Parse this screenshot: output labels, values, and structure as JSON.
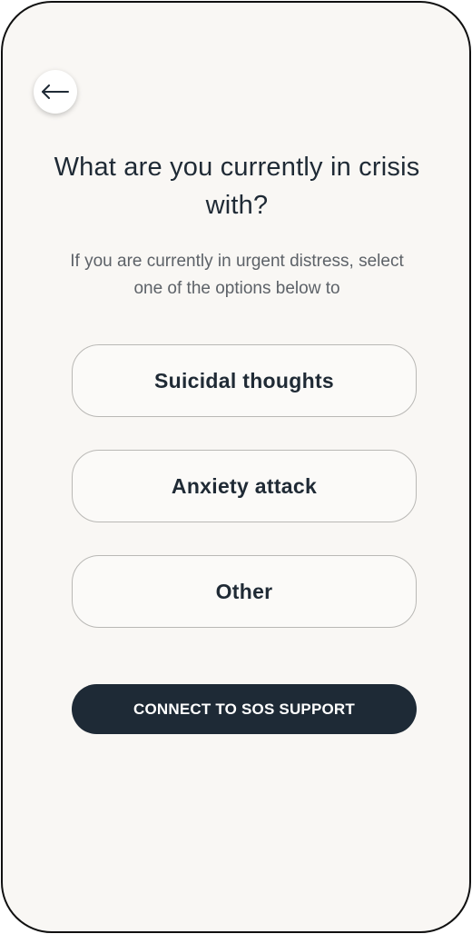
{
  "header": {
    "back_icon": "arrow-left-icon"
  },
  "main": {
    "title": "What are you currently in crisis with?",
    "subtitle": "If you are currently in urgent distress, select one of the options below to",
    "options": [
      {
        "label": "Suicidal thoughts"
      },
      {
        "label": "Anxiety attack"
      },
      {
        "label": "Other"
      }
    ],
    "cta_label": "CONNECT TO SOS SUPPORT"
  },
  "colors": {
    "background": "#f9f7f4",
    "text_primary": "#1f2a35",
    "text_secondary": "#5d6268",
    "option_border": "#b9b8b5",
    "cta_background": "#1e2a36",
    "cta_text": "#ffffff"
  }
}
